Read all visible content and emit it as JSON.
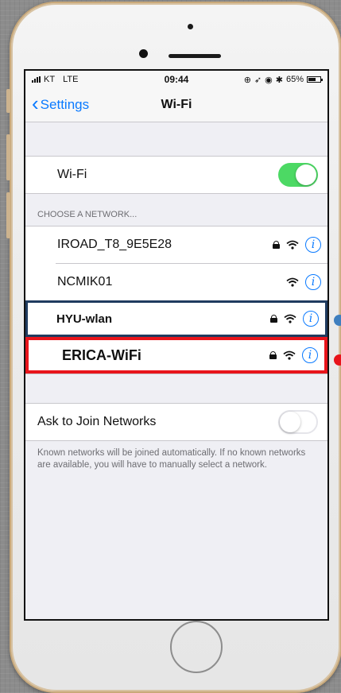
{
  "status_bar": {
    "carrier": "KT",
    "network": "LTE",
    "time": "09:44",
    "status_icons": [
      "alarm-icon",
      "location-icon",
      "clock-icon",
      "bluetooth-icon"
    ],
    "battery": "65%",
    "battery_level": 0.65
  },
  "nav": {
    "back_label": "Settings",
    "title": "Wi-Fi"
  },
  "wifi_toggle": {
    "label": "Wi-Fi",
    "on": true
  },
  "networks_section": {
    "header": "CHOOSE A NETWORK...",
    "networks": [
      {
        "name": "IROAD_T8_9E5E28",
        "locked": true
      },
      {
        "name": "NCMIK01",
        "locked": false
      },
      {
        "name": "HYU-wlan",
        "locked": true,
        "highlight": "blue"
      },
      {
        "name": "ERICA-WiFi",
        "locked": true,
        "highlight": "red"
      }
    ]
  },
  "ask_to_join": {
    "label": "Ask to Join Networks",
    "on": false,
    "footer": "Known networks will be joined automatically. If no known networks are available, you will have to manually select a network."
  },
  "colors": {
    "ios_blue": "#0a7aff",
    "toggle_green": "#4cd964",
    "highlight_blue": "#1f3b5f",
    "highlight_red": "#e8141b"
  }
}
